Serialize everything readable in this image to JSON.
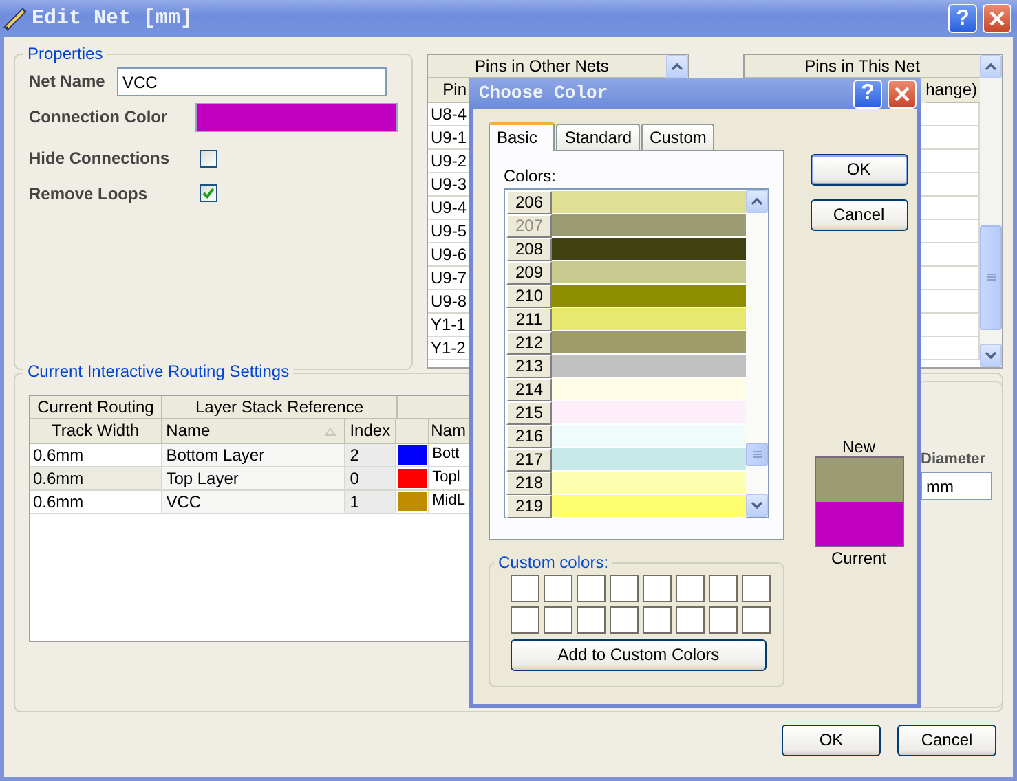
{
  "window": {
    "title": "Edit Net [mm]",
    "help_glyph": "?"
  },
  "properties": {
    "title": "Properties",
    "net_name_label": "Net Name",
    "net_name": "VCC",
    "connection_color_label": "Connection Color",
    "connection_swatch": {
      "color": "#c000c0"
    },
    "options": [
      {
        "label": "Hide Connections",
        "checked": false
      },
      {
        "label": "Remove Loops",
        "checked": true
      }
    ]
  },
  "other_nets_table": {
    "title": "Pins in Other Nets",
    "columns": [
      "Pin"
    ],
    "rows": [
      "U8-4",
      "U9-1",
      "U9-2",
      "U9-3",
      "U9-4",
      "U9-5",
      "U9-6",
      "U9-7",
      "U9-8",
      "Y1-1",
      "Y1-2"
    ]
  },
  "this_net_table": {
    "title": "Pins in This Net",
    "columns": [
      "hange)"
    ]
  },
  "routing": {
    "title": "Current Interactive Routing Settings",
    "group_headers": [
      "Current Routing",
      "Layer Stack Reference"
    ],
    "columns": [
      {
        "label": "Track Width"
      },
      {
        "label": "Name",
        "sorted": true
      },
      {
        "label": "Index"
      },
      {
        "kind": "color"
      },
      {
        "label": "Nam"
      }
    ],
    "rows": [
      {
        "track_width": "0.6mm",
        "name": "Bottom Layer",
        "index": "2",
        "color": "#0000ff",
        "name_2": "Bott",
        "selected": false
      },
      {
        "track_width": "0.6mm",
        "name": "Top Layer",
        "index": "0",
        "color": "#ff0000",
        "name_2": "Topl",
        "selected": true
      },
      {
        "track_width": "0.6mm",
        "name": "VCC",
        "index": "1",
        "color": "#c08c00",
        "name_2": "MidL",
        "selected": false
      }
    ]
  },
  "via": {
    "label": "Diameter",
    "value": "mm"
  },
  "buttons": [
    "OK",
    "Cancel"
  ],
  "dialog": {
    "title": "Choose Color",
    "help_glyph": "?",
    "tabs": [
      {
        "label": "Basic",
        "selected": true
      },
      {
        "label": "Standard",
        "selected": false
      },
      {
        "label": "Custom",
        "selected": false
      }
    ],
    "colors_label": "Colors:",
    "colors": [
      {
        "number": "206",
        "color": "#dfe096",
        "disabled": false
      },
      {
        "number": "207",
        "color": "#9c9c74",
        "disabled": true
      },
      {
        "number": "208",
        "color": "#3f4111",
        "disabled": false
      },
      {
        "number": "209",
        "color": "#c8ca90",
        "disabled": false
      },
      {
        "number": "210",
        "color": "#8e8e00",
        "disabled": false
      },
      {
        "number": "211",
        "color": "#e8e870",
        "disabled": false
      },
      {
        "number": "212",
        "color": "#a09c6a",
        "disabled": false
      },
      {
        "number": "213",
        "color": "#c0c0c0",
        "disabled": false
      },
      {
        "number": "214",
        "color": "#fffde8",
        "disabled": false
      },
      {
        "number": "215",
        "color": "#fdeefa",
        "disabled": false
      },
      {
        "number": "216",
        "color": "#f0fcfc",
        "disabled": false
      },
      {
        "number": "217",
        "color": "#c6e8e8",
        "disabled": false
      },
      {
        "number": "218",
        "color": "#fefeb0",
        "disabled": false
      },
      {
        "number": "219",
        "color": "#fefe70",
        "disabled": false
      }
    ],
    "buttons": [
      "OK",
      "Cancel"
    ],
    "new_label": "New",
    "new_swatch": {
      "color": "#9c9c74"
    },
    "current_label": "Current",
    "current_swatch": {
      "color": "#c000c0"
    },
    "custom_colors_label": "Custom colors:",
    "custom_colors": [
      {
        "color": "#ffffff"
      },
      {
        "color": "#ffffff"
      },
      {
        "color": "#ffffff"
      },
      {
        "color": "#ffffff"
      },
      {
        "color": "#ffffff"
      },
      {
        "color": "#ffffff"
      },
      {
        "color": "#ffffff"
      },
      {
        "color": "#ffffff"
      },
      {
        "color": "#ffffff"
      },
      {
        "color": "#ffffff"
      },
      {
        "color": "#ffffff"
      },
      {
        "color": "#ffffff"
      },
      {
        "color": "#ffffff"
      },
      {
        "color": "#ffffff"
      },
      {
        "color": "#ffffff"
      },
      {
        "color": "#ffffff"
      }
    ],
    "add_button": "Add to Custom Colors"
  }
}
